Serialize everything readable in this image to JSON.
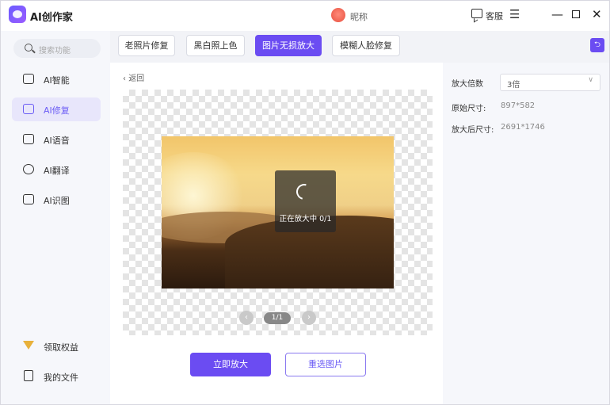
{
  "app": {
    "title": "AI创作家",
    "nickname": "昵称",
    "service_label": "客服",
    "menu_glyph": "☰",
    "min_glyph": "—",
    "close_glyph": "✕"
  },
  "sidebar": {
    "search_placeholder": "搜索功能",
    "items": [
      {
        "label": "AI智能",
        "icon": "ai-chip-icon"
      },
      {
        "label": "AI修复",
        "icon": "repair-icon"
      },
      {
        "label": "AI语音",
        "icon": "voice-icon"
      },
      {
        "label": "AI翻译",
        "icon": "translate-icon"
      },
      {
        "label": "AI识图",
        "icon": "image-recognize-icon"
      }
    ],
    "active_index": 1,
    "bottom_items": [
      {
        "label": "领取权益",
        "icon": "crown-icon"
      },
      {
        "label": "我的文件",
        "icon": "file-icon"
      }
    ]
  },
  "tabs": [
    {
      "label": "老照片修复"
    },
    {
      "label": "黑白照上色"
    },
    {
      "label": "图片无损放大"
    },
    {
      "label": "模糊人脸修复"
    }
  ],
  "active_tab": 2,
  "main": {
    "back_glyph": "‹",
    "back_label": "返回",
    "loading_text": "正在放大中 0/1",
    "pager": {
      "prev_glyph": "‹",
      "count": "1/1",
      "next_glyph": "›"
    },
    "enlarge_button": "立即放大",
    "reselect_button": "重选图片"
  },
  "panel": {
    "scale_label": "放大倍数",
    "scale_value": "3倍",
    "scale_chevron": "∨",
    "original_label": "原始尺寸:",
    "original_value": "897*582",
    "enlarged_label": "放大后尺寸:",
    "enlarged_value": "2691*1746",
    "toggle_glyph": "⮌"
  },
  "colors": {
    "accent": "#6b4cf2",
    "active_nav_bg": "#e8e6fb"
  }
}
